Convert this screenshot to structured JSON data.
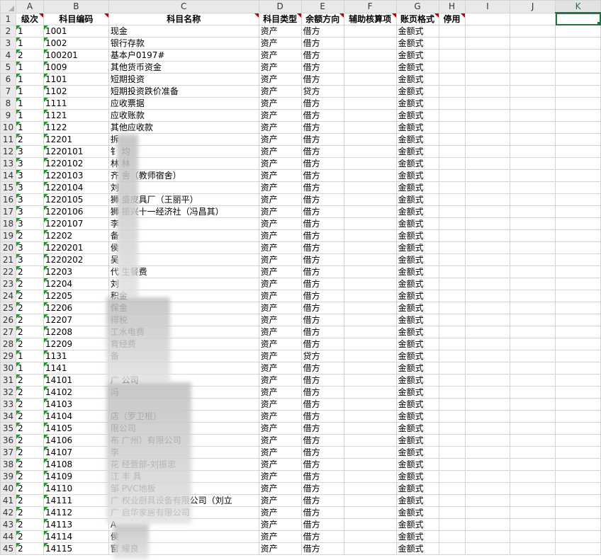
{
  "columns": [
    "A",
    "B",
    "C",
    "D",
    "E",
    "F",
    "G",
    "H",
    "I",
    "J",
    "K"
  ],
  "selected_column": "K",
  "header_row": {
    "row": "1",
    "level": "级次",
    "code": "科目编码",
    "name": "科目名称",
    "type": "科目类型",
    "direction": "余额方向",
    "aux": "辅助核算项",
    "format": "账页格式",
    "disabled": "停用"
  },
  "rows": [
    {
      "row": "2",
      "level": "1",
      "code": "1001",
      "name": "现金",
      "type": "资产",
      "direction": "借方",
      "format": "金额式"
    },
    {
      "row": "3",
      "level": "1",
      "code": "1002",
      "name": "银行存款",
      "type": "资产",
      "direction": "借方",
      "format": "金额式"
    },
    {
      "row": "4",
      "level": "2",
      "code": "100201",
      "name": "基本户0197#",
      "type": "资产",
      "direction": "借方",
      "format": "金额式"
    },
    {
      "row": "5",
      "level": "1",
      "code": "1009",
      "name": "其他货币资金",
      "type": "资产",
      "direction": "借方",
      "format": "金额式"
    },
    {
      "row": "6",
      "level": "1",
      "code": "1101",
      "name": "短期投资",
      "type": "资产",
      "direction": "借方",
      "format": "金额式"
    },
    {
      "row": "7",
      "level": "1",
      "code": "1102",
      "name": "短期投资跌价准备",
      "type": "资产",
      "direction": "贷方",
      "format": "金额式"
    },
    {
      "row": "8",
      "level": "1",
      "code": "1111",
      "name": "应收票据",
      "type": "资产",
      "direction": "借方",
      "format": "金额式"
    },
    {
      "row": "9",
      "level": "1",
      "code": "1121",
      "name": "应收账款",
      "type": "资产",
      "direction": "借方",
      "format": "金额式"
    },
    {
      "row": "10",
      "level": "1",
      "code": "1122",
      "name": "其他应收款",
      "type": "资产",
      "direction": "借方",
      "format": "金额式"
    },
    {
      "row": "11",
      "level": "2",
      "code": "12201",
      "name": "拆",
      "type": "资产",
      "direction": "借方",
      "format": "金额式"
    },
    {
      "row": "12",
      "level": "3",
      "code": "1220101",
      "name": "钅      均",
      "type": "资产",
      "direction": "借方",
      "format": "金额式"
    },
    {
      "row": "13",
      "level": "3",
      "code": "1220102",
      "name": "林      林",
      "type": "资产",
      "direction": "借方",
      "format": "金额式"
    },
    {
      "row": "14",
      "level": "3",
      "code": "1220103",
      "name": "齐      舍（教师宿舍）",
      "type": "资产",
      "direction": "借方",
      "format": "金额式"
    },
    {
      "row": "15",
      "level": "3",
      "code": "1220104",
      "name": "刘",
      "type": "资产",
      "direction": "借方",
      "format": "金额式"
    },
    {
      "row": "16",
      "level": "3",
      "code": "1220105",
      "name": "狮      盛皮具厂（王丽平）",
      "type": "资产",
      "direction": "借方",
      "format": "金额式"
    },
    {
      "row": "17",
      "level": "3",
      "code": "1220106",
      "name": "狮      振兴十一经济社（冯昌其）",
      "type": "资产",
      "direction": "借方",
      "format": "金额式"
    },
    {
      "row": "18",
      "level": "3",
      "code": "1220107",
      "name": "李",
      "type": "资产",
      "direction": "借方",
      "format": "金额式"
    },
    {
      "row": "19",
      "level": "2",
      "code": "12202",
      "name": "备",
      "type": "资产",
      "direction": "借方",
      "format": "金额式"
    },
    {
      "row": "20",
      "level": "3",
      "code": "1220201",
      "name": "侯",
      "type": "资产",
      "direction": "借方",
      "format": "金额式"
    },
    {
      "row": "21",
      "level": "3",
      "code": "1220202",
      "name": "吴",
      "type": "资产",
      "direction": "借方",
      "format": "金额式"
    },
    {
      "row": "22",
      "level": "2",
      "code": "12203",
      "name": "代      生餐费",
      "type": "资产",
      "direction": "借方",
      "format": "金额式"
    },
    {
      "row": "23",
      "level": "2",
      "code": "12204",
      "name": "刘",
      "type": "资产",
      "direction": "借方",
      "format": "金额式"
    },
    {
      "row": "24",
      "level": "2",
      "code": "12205",
      "name": "        积金",
      "type": "资产",
      "direction": "借方",
      "format": "金额式"
    },
    {
      "row": "25",
      "level": "2",
      "code": "12206",
      "name": "        保金",
      "type": "资产",
      "direction": "借方",
      "format": "金额式"
    },
    {
      "row": "26",
      "level": "2",
      "code": "12207",
      "name": "        得税",
      "type": "资产",
      "direction": "借方",
      "format": "金额式"
    },
    {
      "row": "27",
      "level": "2",
      "code": "12208",
      "name": "        工水电费",
      "type": "资产",
      "direction": "借方",
      "format": "金额式"
    },
    {
      "row": "28",
      "level": "2",
      "code": "12209",
      "name": "        育经费",
      "type": "资产",
      "direction": "借方",
      "format": "金额式"
    },
    {
      "row": "29",
      "level": "1",
      "code": "1131",
      "name": "        备",
      "type": "资产",
      "direction": "贷方",
      "format": "金额式"
    },
    {
      "row": "30",
      "level": "1",
      "code": "1141",
      "name": "",
      "type": "资产",
      "direction": "借方",
      "format": "金额式"
    },
    {
      "row": "31",
      "level": "2",
      "code": "14101",
      "name": "广                    公司",
      "type": "资产",
      "direction": "借方",
      "format": "金额式"
    },
    {
      "row": "32",
      "level": "2",
      "code": "14102",
      "name": "冯",
      "type": "资产",
      "direction": "借方",
      "format": "金额式"
    },
    {
      "row": "33",
      "level": "2",
      "code": "14103",
      "name": "",
      "type": "资产",
      "direction": "借方",
      "format": "金额式"
    },
    {
      "row": "34",
      "level": "2",
      "code": "14104",
      "name": "                    店（罗卫根）",
      "type": "资产",
      "direction": "借方",
      "format": "金额式"
    },
    {
      "row": "35",
      "level": "2",
      "code": "14105",
      "name": "                    限公司",
      "type": "资产",
      "direction": "借方",
      "format": "金额式"
    },
    {
      "row": "36",
      "level": "2",
      "code": "14106",
      "name": "布                  广州）有限公司",
      "type": "资产",
      "direction": "借方",
      "format": "金额式"
    },
    {
      "row": "37",
      "level": "2",
      "code": "14107",
      "name": "李",
      "type": "资产",
      "direction": "借方",
      "format": "金额式"
    },
    {
      "row": "38",
      "level": "2",
      "code": "14108",
      "name": "花                  经营部-刘振忠",
      "type": "资产",
      "direction": "借方",
      "format": "金额式"
    },
    {
      "row": "39",
      "level": "2",
      "code": "14109",
      "name": "江      丰      具",
      "type": "资产",
      "direction": "借方",
      "format": "金额式"
    },
    {
      "row": "40",
      "level": "2",
      "code": "14110",
      "name": "邹      PVC地板",
      "type": "资产",
      "direction": "借方",
      "format": "金额式"
    },
    {
      "row": "41",
      "level": "2",
      "code": "14111",
      "name": "广      权业厨具设备有限公司（刘立",
      "type": "资产",
      "direction": "借方",
      "format": "金额式"
    },
    {
      "row": "42",
      "level": "2",
      "code": "14112",
      "name": "广      启华家居有限公司",
      "type": "资产",
      "direction": "借方",
      "format": "金额式"
    },
    {
      "row": "43",
      "level": "2",
      "code": "14113",
      "name": "A",
      "type": "资产",
      "direction": "借方",
      "format": "金额式"
    },
    {
      "row": "44",
      "level": "2",
      "code": "14114",
      "name": "侯",
      "type": "资产",
      "direction": "借方",
      "format": "金额式"
    },
    {
      "row": "45",
      "level": "2",
      "code": "14115",
      "name": "窗      耀良",
      "type": "资产",
      "direction": "借方",
      "format": "金额式"
    }
  ]
}
